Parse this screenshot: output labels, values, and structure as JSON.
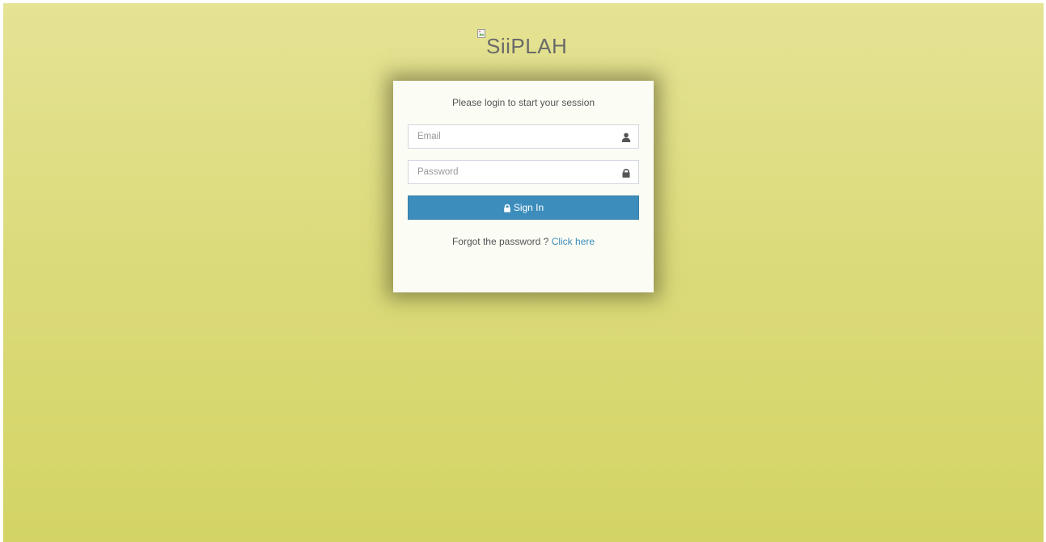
{
  "logo": {
    "text": "SiiPLAH",
    "icon": "broken-image-icon"
  },
  "login": {
    "message": "Please login to start your session",
    "email": {
      "placeholder": "Email",
      "value": "",
      "icon": "user-icon"
    },
    "password": {
      "placeholder": "Password",
      "value": "",
      "icon": "lock-icon"
    },
    "signin": {
      "label": "Sign In",
      "icon": "lock-icon"
    },
    "forgot": {
      "text": "Forgot the password ?",
      "link_label": "Click here"
    }
  },
  "colors": {
    "background_top": "#e5e394",
    "background_bottom": "#d3d465",
    "box": "#fbfcf4",
    "primary": "#3c8dbc",
    "link": "#3c8dbc"
  }
}
